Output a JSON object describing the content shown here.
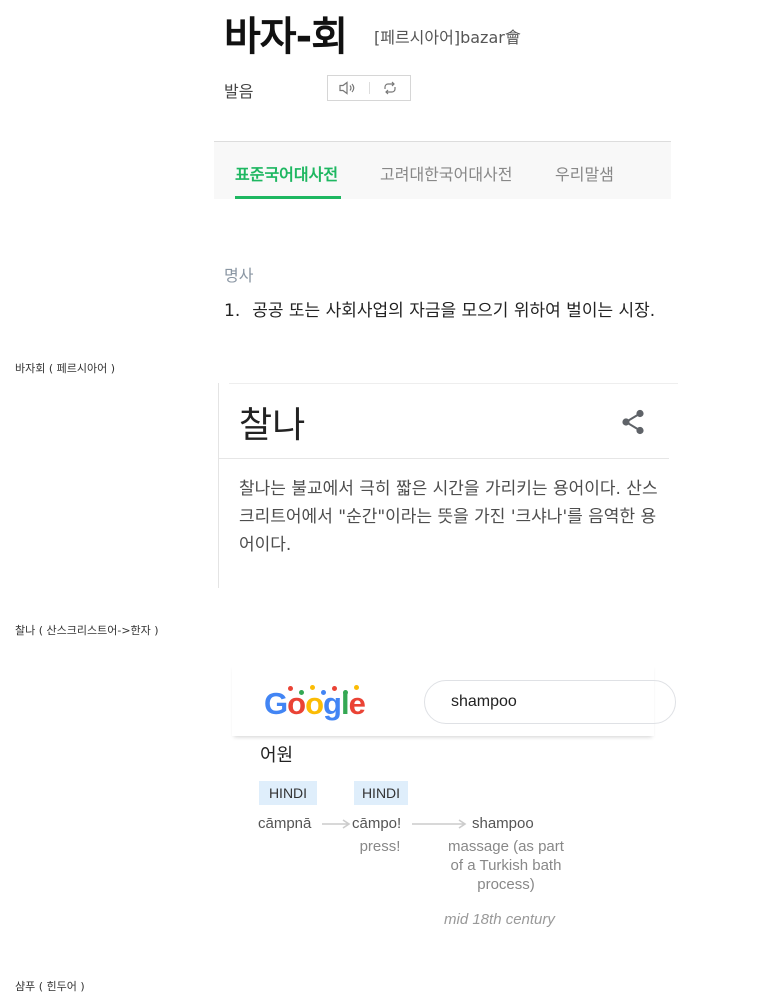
{
  "dictionary": {
    "headword": "바자-회",
    "origin": "[페르시아어]bazar會",
    "pronunciation_label": "발음",
    "tabs": [
      {
        "label": "표준국어대사전",
        "active": true
      },
      {
        "label": "고려대한국어대사전",
        "active": false
      },
      {
        "label": "우리말샘",
        "active": false
      }
    ],
    "part_of_speech": "명사",
    "definition_number": "1.",
    "definition": "공공 또는 사회사업의 자금을 모으기 위하여 벌이는 시장.",
    "accent_color": "#1eb761"
  },
  "captions": {
    "c1": "바자회 ( 페르시아어 )",
    "c2": "찰나 ( 산스크리스트어->한자 )",
    "c3": "샴푸 ( 힌두어 )"
  },
  "card": {
    "title": "찰나",
    "body": "찰나는 불교에서 극히 짧은 시간을 가리키는 용어이다. 산스크리트어에서 \"순간\"이라는 뜻을 가진 '크샤나'를 음역한 용어이다.",
    "share_icon": "share-icon"
  },
  "google": {
    "logo": [
      "G",
      "o",
      "o",
      "g",
      "l",
      "e"
    ],
    "search_value": "shampoo",
    "etymology_title": "어원",
    "steps": [
      {
        "lang": "HINDI",
        "word": "cāmpnā",
        "gloss": ""
      },
      {
        "lang": "HINDI",
        "word": "cāmpo!",
        "gloss": "press!"
      },
      {
        "lang": "",
        "word": "shampoo",
        "gloss": "massage (as part of a Turkish bath process)"
      }
    ],
    "date": "mid 18th century"
  }
}
